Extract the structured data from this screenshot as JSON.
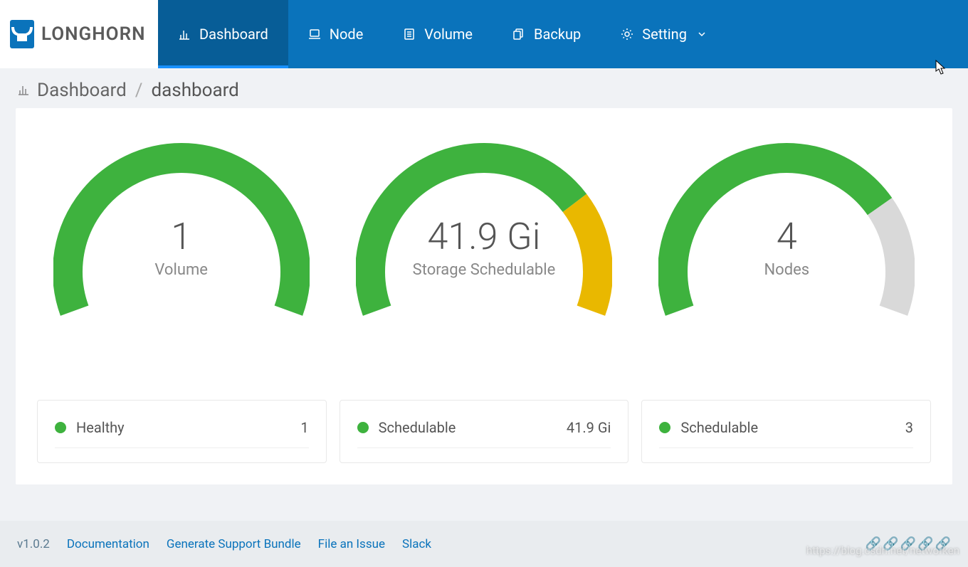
{
  "brand": {
    "name": "LONGHORN"
  },
  "nav": {
    "items": [
      {
        "label": "Dashboard",
        "icon": "barchart-icon",
        "active": true
      },
      {
        "label": "Node",
        "icon": "laptop-icon",
        "active": false
      },
      {
        "label": "Volume",
        "icon": "list-icon",
        "active": false
      },
      {
        "label": "Backup",
        "icon": "copy-icon",
        "active": false
      },
      {
        "label": "Setting",
        "icon": "gear-icon",
        "active": false,
        "has_dropdown": true
      }
    ]
  },
  "breadcrumb": {
    "root": "Dashboard",
    "leaf": "dashboard"
  },
  "gauges": [
    {
      "value": "1",
      "label": "Volume",
      "segments": [
        {
          "color": "#3eb23e",
          "fraction": 1.0
        }
      ]
    },
    {
      "value": "41.9 Gi",
      "label": "Storage Schedulable",
      "segments": [
        {
          "color": "#3eb23e",
          "fraction": 0.74
        },
        {
          "color": "#e9b800",
          "fraction": 0.26
        }
      ]
    },
    {
      "value": "4",
      "label": "Nodes",
      "segments": [
        {
          "color": "#3eb23e",
          "fraction": 0.75
        },
        {
          "color": "#d9d9d9",
          "fraction": 0.25
        }
      ]
    }
  ],
  "stat_cards": [
    {
      "rows": [
        {
          "dot": "green",
          "label": "Healthy",
          "value": "1"
        }
      ]
    },
    {
      "rows": [
        {
          "dot": "green",
          "label": "Schedulable",
          "value": "41.9 Gi"
        }
      ]
    },
    {
      "rows": [
        {
          "dot": "green",
          "label": "Schedulable",
          "value": "3"
        }
      ]
    }
  ],
  "footer": {
    "version": "v1.0.2",
    "links": [
      {
        "label": "Documentation"
      },
      {
        "label": "Generate Support Bundle"
      },
      {
        "label": "File an Issue"
      },
      {
        "label": "Slack"
      }
    ]
  },
  "watermark": "https://blog.csdn.net/networken",
  "colors": {
    "primary": "#0a73bb",
    "green": "#3eb23e",
    "yellow": "#e9b800",
    "grey": "#d9d9d9"
  }
}
